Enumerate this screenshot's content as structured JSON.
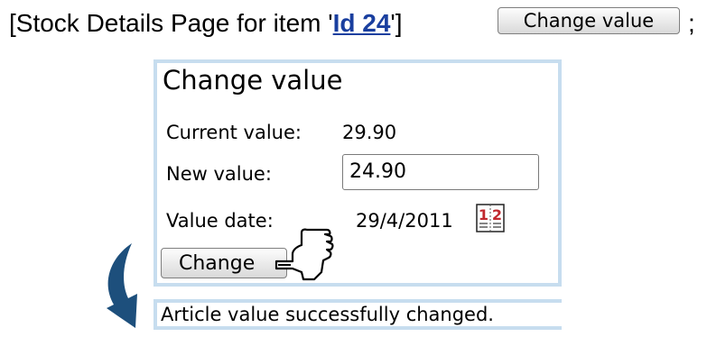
{
  "header": {
    "prefix": "[Stock Details Page for item '",
    "item_link": "Id 24",
    "suffix": "']",
    "button_label": "Change value",
    "trail": ";"
  },
  "panel": {
    "title": "Change value",
    "current_value_label": "Current value:",
    "current_value": "29.90",
    "new_value_label": "New value:",
    "new_value": "24.90",
    "value_date_label": "Value date:",
    "value_date": "29/4/2011",
    "calendar_digits": [
      "1",
      "2"
    ],
    "change_button_label": "Change"
  },
  "status": {
    "message": "Article value successfully changed."
  },
  "colors": {
    "panel_border": "#c7ddef",
    "link": "#1a3f9f",
    "arrow": "#1d4f7c",
    "calendar_red": "#c0282e"
  },
  "icons": [
    "calendar-icon",
    "pointing-hand-icon",
    "curved-arrow-icon"
  ]
}
